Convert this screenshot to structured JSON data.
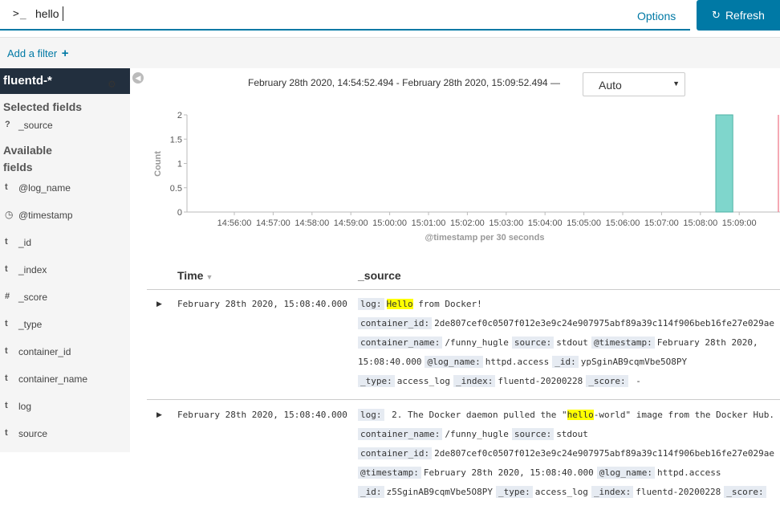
{
  "search": {
    "prompt": ">_",
    "query": "hello",
    "options_label": "Options",
    "refresh_label": "Refresh"
  },
  "filters": {
    "add_label": "Add a filter"
  },
  "sidebar": {
    "index_pattern": "fluentd-*",
    "selected_heading": "Selected fields",
    "selected_fields": [
      {
        "type": "?",
        "name": "_source"
      }
    ],
    "available_heading": "Available fields",
    "available_fields": [
      {
        "type": "t",
        "name": "@log_name"
      },
      {
        "type": "clock",
        "name": "@timestamp"
      },
      {
        "type": "t",
        "name": "_id"
      },
      {
        "type": "t",
        "name": "_index"
      },
      {
        "type": "#",
        "name": "_score"
      },
      {
        "type": "t",
        "name": "_type"
      },
      {
        "type": "t",
        "name": "container_id"
      },
      {
        "type": "t",
        "name": "container_name"
      },
      {
        "type": "t",
        "name": "log"
      },
      {
        "type": "t",
        "name": "source"
      }
    ]
  },
  "time_range": "February 28th 2020, 14:54:52.494 - February 28th 2020, 15:09:52.494 —",
  "interval": "Auto",
  "chart_data": {
    "type": "bar",
    "ylabel": "Count",
    "xlabel": "@timestamp per 30 seconds",
    "ylim": [
      0,
      2
    ],
    "yticks": [
      "0",
      "0.5",
      "1",
      "1.5",
      "2"
    ],
    "xticks": [
      "14:56:00",
      "14:57:00",
      "14:58:00",
      "14:59:00",
      "15:00:00",
      "15:01:00",
      "15:02:00",
      "15:03:00",
      "15:04:00",
      "15:05:00",
      "15:06:00",
      "15:07:00",
      "15:08:00",
      "15:09:00"
    ],
    "bars": [
      {
        "x": "15:08:30",
        "value": 2
      }
    ],
    "bar_color": "#7fd6cc",
    "bar_stroke": "#4fb2a6"
  },
  "table": {
    "col_time": "Time",
    "col_source": "_source",
    "rows": [
      {
        "time": "February 28th 2020, 15:08:40.000",
        "log_key": "log:",
        "log_hl": "Hello",
        "log_rest": " from Docker!",
        "line2": [
          {
            "k": "container_id:",
            "v": "2de807cef0c0507f012e3e9c24e907975abf89a39c114f906beb16fe27e029ae"
          }
        ],
        "line3": [
          {
            "k": "container_name:",
            "v": "/funny_hugle"
          },
          {
            "k": "source:",
            "v": "stdout"
          },
          {
            "k": "@timestamp:",
            "v": "February 28th 2020,"
          }
        ],
        "line4_pre": "15:08:40.000",
        "line4": [
          {
            "k": "@log_name:",
            "v": "httpd.access"
          },
          {
            "k": "_id:",
            "v": "ypSginAB9cqmVbe5O8PY"
          }
        ],
        "line5": [
          {
            "k": "_type:",
            "v": "access_log"
          },
          {
            "k": "_index:",
            "v": "fluentd-20200228"
          },
          {
            "k": "_score:",
            "v": " -"
          }
        ]
      },
      {
        "time": "February 28th 2020, 15:08:40.000",
        "log_key": "log:",
        "log_pre": " 2. The Docker daemon pulled the \"",
        "log_hl": "hello",
        "log_rest": "-world\" image from the Docker Hub.",
        "line2": [
          {
            "k": "container_name:",
            "v": "/funny_hugle"
          },
          {
            "k": "source:",
            "v": "stdout"
          }
        ],
        "line3": [
          {
            "k": "container_id:",
            "v": "2de807cef0c0507f012e3e9c24e907975abf89a39c114f906beb16fe27e029ae"
          }
        ],
        "line4": [
          {
            "k": "@timestamp:",
            "v": "February 28th 2020, 15:08:40.000"
          },
          {
            "k": "@log_name:",
            "v": "httpd.access"
          }
        ],
        "line5": [
          {
            "k": "_id:",
            "v": "z5SginAB9cqmVbe5O8PY"
          },
          {
            "k": "_type:",
            "v": "access_log"
          },
          {
            "k": "_index:",
            "v": "fluentd-20200228"
          },
          {
            "k": "_score:",
            "v": ""
          }
        ]
      }
    ]
  }
}
